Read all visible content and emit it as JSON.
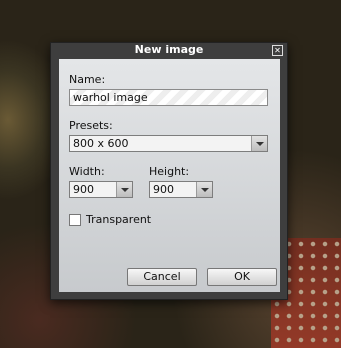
{
  "dialog": {
    "title": "New image",
    "name_label": "Name:",
    "name_value": "warhol image",
    "presets_label": "Presets:",
    "preset_value": "800 x 600",
    "width_label": "Width:",
    "width_value": "900",
    "height_label": "Height:",
    "height_value": "900",
    "transparent_label": "Transparent",
    "transparent_checked": false,
    "cancel_label": "Cancel",
    "ok_label": "OK"
  },
  "icons": [
    "close-icon",
    "chevron-down-icon"
  ],
  "colors": {
    "titlebar": "#3e3e3e",
    "panel_top": "#e4e6e8",
    "panel_bottom": "#c7cacd"
  }
}
